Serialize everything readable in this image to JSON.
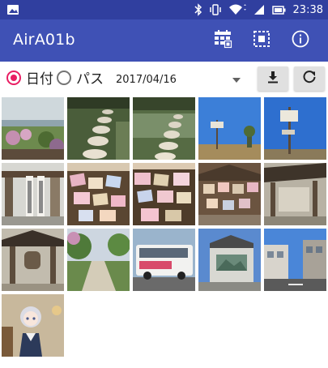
{
  "status_bar": {
    "time": "23:38",
    "icons": [
      "image-notification-icon",
      "bluetooth-icon",
      "vibrate-icon",
      "wifi-icon",
      "cell-signal-icon",
      "battery-icon"
    ]
  },
  "app_bar": {
    "title": "AirA01b",
    "actions": [
      "calendar-grid-icon",
      "select-area-icon",
      "info-icon"
    ]
  },
  "controls": {
    "radio_date_label": "日付",
    "radio_path_label": "パス",
    "selected_mode": "date",
    "date_value": "2017/04/16",
    "download_icon": "download-icon",
    "refresh_icon": "refresh-icon"
  },
  "photos": [
    {
      "subject": "hillside view with blossoms"
    },
    {
      "subject": "stepping stones in stream"
    },
    {
      "subject": "stepping stones in stream"
    },
    {
      "subject": "signpost against blue sky"
    },
    {
      "subject": "signpost against blue sky"
    },
    {
      "subject": "shrine gate with banners"
    },
    {
      "subject": "wooden ema votive plaques"
    },
    {
      "subject": "wooden ema votive plaques"
    },
    {
      "subject": "shrine hut with plaques"
    },
    {
      "subject": "shrine building eaves"
    },
    {
      "subject": "shrine bell tower"
    },
    {
      "subject": "garden path with trees"
    },
    {
      "subject": "city bus on street"
    },
    {
      "subject": "building with mural"
    },
    {
      "subject": "street with buildings"
    },
    {
      "subject": "anime girl figure panel"
    }
  ],
  "colors": {
    "status_bar": "#303f9f",
    "app_bar": "#3f51b5",
    "accent": "#e91e63"
  }
}
